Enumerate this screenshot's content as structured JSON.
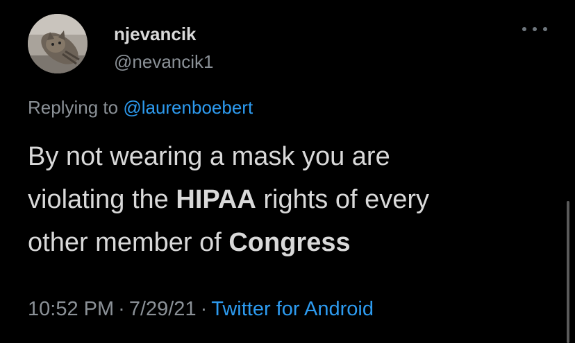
{
  "user": {
    "display_name": "njevancik",
    "handle": "@nevancik1",
    "avatar_icon": "cat-avatar-icon"
  },
  "menu": {
    "icon": "more-options-icon"
  },
  "reply": {
    "prefix": "Replying to",
    "mention": "@laurenboebert"
  },
  "tweet": {
    "line1": "By not wearing a mask you are",
    "line2_a": "violating the ",
    "line2_b": "HIPAA",
    "line2_c": " rights of every",
    "line3_a": "other member of ",
    "line3_b": "Congress"
  },
  "meta": {
    "time": "10:52 PM",
    "separator": "·",
    "date": "7/29/21",
    "source": "Twitter for Android"
  },
  "colors": {
    "background": "#000000",
    "text": "#d9d9d9",
    "muted": "#8b9197",
    "link": "#2d9bf0"
  }
}
